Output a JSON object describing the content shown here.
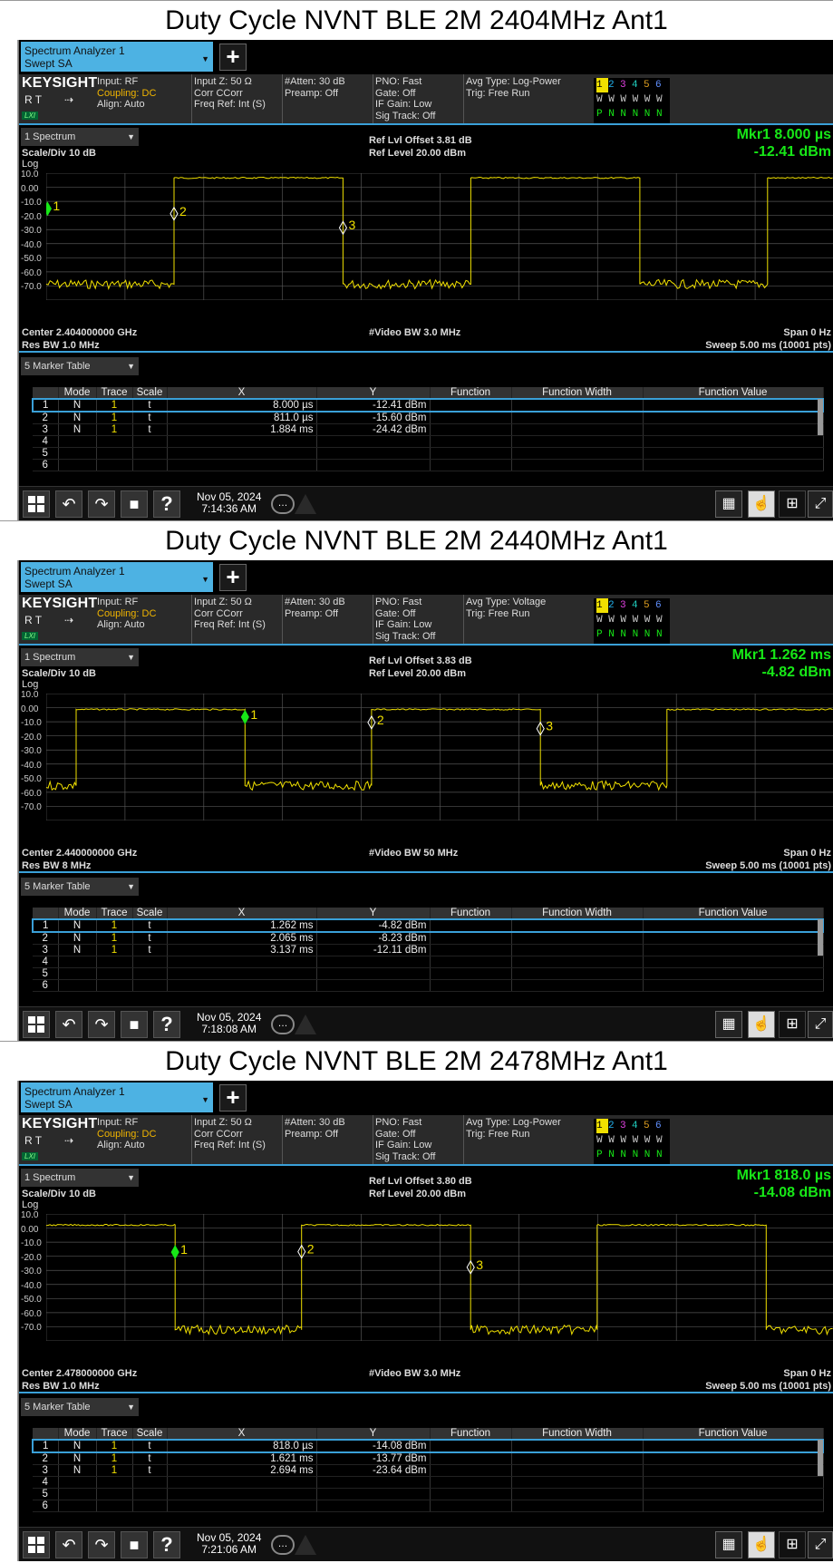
{
  "panels": [
    {
      "title": "Duty Cycle NVNT BLE 2M 2404MHz Ant1",
      "tab": {
        "line1": "Spectrum Analyzer 1",
        "line2": "Swept SA"
      },
      "brand": "KEYSIGHT",
      "rt": "R  T",
      "lxi": "LXI",
      "input": [
        "Input: RF",
        "Coupling: DC",
        "Align: Auto"
      ],
      "inputz": [
        "Input Z: 50 Ω",
        "Corr CCorr",
        "Freq Ref: Int (S)"
      ],
      "atten": [
        "#Atten: 30 dB",
        "Preamp: Off"
      ],
      "pno": [
        "PNO: Fast",
        "Gate: Off",
        "IF Gain: Low",
        "Sig Track: Off"
      ],
      "avg": [
        "Avg Type: Log-Power",
        "Trig: Free Run"
      ],
      "trace_rows": {
        "nums": [
          "1",
          "2",
          "3",
          "4",
          "5",
          "6"
        ],
        "w": "W W W W W W",
        "p": "P N N N N N"
      },
      "mode_label": "1 Spectrum",
      "scale_div": "Scale/Div 10 dB",
      "ref_offset": "Ref Lvl Offset 3.81 dB",
      "ref_level": "Ref Level 20.00 dBm",
      "mkr_line1": "Mkr1  8.000 µs",
      "mkr_line2": "-12.41 dBm",
      "log_label": "Log",
      "yticks": [
        "10.0",
        "0.00",
        "-10.0",
        "-20.0",
        "-30.0",
        "-40.0",
        "-50.0",
        "-60.0",
        "-70.0"
      ],
      "center": "Center 2.404000000 GHz",
      "res_bw": "Res BW 1.0 MHz",
      "video_bw": "#Video BW 3.0 MHz",
      "span": "Span 0 Hz",
      "sweep": "Sweep 5.00 ms (10001 pts)",
      "table_label": "5 Marker Table",
      "table_headers": [
        "",
        "Mode",
        "Trace",
        "Scale",
        "X",
        "Y",
        "Function",
        "Function Width",
        "Function Value"
      ],
      "rows": [
        {
          "n": "1",
          "mode": "N",
          "trace": "1",
          "scale": "t",
          "x": "8.000 µs",
          "y": "-12.41 dBm"
        },
        {
          "n": "2",
          "mode": "N",
          "trace": "1",
          "scale": "t",
          "x": "811.0 µs",
          "y": "-15.60 dBm"
        },
        {
          "n": "3",
          "mode": "N",
          "trace": "1",
          "scale": "t",
          "x": "1.884 ms",
          "y": "-24.42 dBm"
        },
        {
          "n": "4",
          "mode": "",
          "trace": "",
          "scale": "",
          "x": "",
          "y": ""
        },
        {
          "n": "5",
          "mode": "",
          "trace": "",
          "scale": "",
          "x": "",
          "y": ""
        },
        {
          "n": "6",
          "mode": "",
          "trace": "",
          "scale": "",
          "x": "",
          "y": ""
        }
      ],
      "date": "Nov 05, 2024",
      "time": "7:14:36 AM",
      "trace": {
        "high_db": 7,
        "low_db": -60,
        "edges_ms": [
          0.811,
          1.884,
          2.695,
          3.768,
          4.579
        ],
        "start_high": false
      },
      "markers": [
        {
          "label": "1",
          "t_ms": 0.008,
          "db": -12.41
        },
        {
          "label": "2",
          "t_ms": 0.811,
          "db": -15.6
        },
        {
          "label": "3",
          "t_ms": 1.884,
          "db": -24.42
        }
      ]
    },
    {
      "title": "Duty Cycle NVNT BLE 2M 2440MHz Ant1",
      "tab": {
        "line1": "Spectrum Analyzer 1",
        "line2": "Swept SA"
      },
      "brand": "KEYSIGHT",
      "rt": "R  T",
      "lxi": "LXI",
      "input": [
        "Input: RF",
        "Coupling: DC",
        "Align: Auto"
      ],
      "inputz": [
        "Input Z: 50 Ω",
        "Corr CCorr",
        "Freq Ref: Int (S)"
      ],
      "atten": [
        "#Atten: 30 dB",
        "Preamp: Off"
      ],
      "pno": [
        "PNO: Fast",
        "Gate: Off",
        "IF Gain: Low",
        "Sig Track: Off"
      ],
      "avg": [
        "Avg Type: Voltage",
        "Trig: Free Run"
      ],
      "trace_rows": {
        "nums": [
          "1",
          "2",
          "3",
          "4",
          "5",
          "6"
        ],
        "w": "W W W W W W",
        "p": "P N N N N N"
      },
      "mode_label": "1 Spectrum",
      "scale_div": "Scale/Div 10 dB",
      "ref_offset": "Ref Lvl Offset 3.83 dB",
      "ref_level": "Ref Level 20.00 dBm",
      "mkr_line1": "Mkr1  1.262 ms",
      "mkr_line2": "-4.82 dBm",
      "log_label": "Log",
      "yticks": [
        "10.0",
        "0.00",
        "-10.0",
        "-20.0",
        "-30.0",
        "-40.0",
        "-50.0",
        "-60.0",
        "-70.0"
      ],
      "center": "Center 2.440000000 GHz",
      "res_bw": "Res BW 8 MHz",
      "video_bw": "#Video BW 50 MHz",
      "span": "Span 0 Hz",
      "sweep": "Sweep 5.00 ms (10001 pts)",
      "table_label": "5 Marker Table",
      "table_headers": [
        "",
        "Mode",
        "Trace",
        "Scale",
        "X",
        "Y",
        "Function",
        "Function Width",
        "Function Value"
      ],
      "rows": [
        {
          "n": "1",
          "mode": "N",
          "trace": "1",
          "scale": "t",
          "x": "1.262 ms",
          "y": "-4.82 dBm"
        },
        {
          "n": "2",
          "mode": "N",
          "trace": "1",
          "scale": "t",
          "x": "2.065 ms",
          "y": "-8.23 dBm"
        },
        {
          "n": "3",
          "mode": "N",
          "trace": "1",
          "scale": "t",
          "x": "3.137 ms",
          "y": "-12.11 dBm"
        },
        {
          "n": "4",
          "mode": "",
          "trace": "",
          "scale": "",
          "x": "",
          "y": ""
        },
        {
          "n": "5",
          "mode": "",
          "trace": "",
          "scale": "",
          "x": "",
          "y": ""
        },
        {
          "n": "6",
          "mode": "",
          "trace": "",
          "scale": "",
          "x": "",
          "y": ""
        }
      ],
      "date": "Nov 05, 2024",
      "time": "7:18:08 AM",
      "trace": {
        "high_db": 0,
        "low_db": -48,
        "edges_ms": [
          0.19,
          1.262,
          2.065,
          3.137,
          3.94
        ],
        "start_high": false
      },
      "markers": [
        {
          "label": "1",
          "t_ms": 1.262,
          "db": -4.82
        },
        {
          "label": "2",
          "t_ms": 2.065,
          "db": -8.23
        },
        {
          "label": "3",
          "t_ms": 3.137,
          "db": -12.11
        }
      ]
    },
    {
      "title": "Duty Cycle NVNT BLE 2M 2478MHz Ant1",
      "tab": {
        "line1": "Spectrum Analyzer 1",
        "line2": "Swept SA"
      },
      "brand": "KEYSIGHT",
      "rt": "R  T",
      "lxi": "LXI",
      "input": [
        "Input: RF",
        "Coupling: DC",
        "Align: Auto"
      ],
      "inputz": [
        "Input Z: 50 Ω",
        "Corr CCorr",
        "Freq Ref: Int (S)"
      ],
      "atten": [
        "#Atten: 30 dB",
        "Preamp: Off"
      ],
      "pno": [
        "PNO: Fast",
        "Gate: Off",
        "IF Gain: Low",
        "Sig Track: Off"
      ],
      "avg": [
        "Avg Type: Log-Power",
        "Trig: Free Run"
      ],
      "trace_rows": {
        "nums": [
          "1",
          "2",
          "3",
          "4",
          "5",
          "6"
        ],
        "w": "W W W W W W",
        "p": "P N N N N N"
      },
      "mode_label": "1 Spectrum",
      "scale_div": "Scale/Div 10 dB",
      "ref_offset": "Ref Lvl Offset 3.80 dB",
      "ref_level": "Ref Level 20.00 dBm",
      "mkr_line1": "Mkr1  818.0 µs",
      "mkr_line2": "-14.08 dBm",
      "log_label": "Log",
      "yticks": [
        "10.0",
        "0.00",
        "-10.0",
        "-20.0",
        "-30.0",
        "-40.0",
        "-50.0",
        "-60.0",
        "-70.0"
      ],
      "center": "Center 2.478000000 GHz",
      "res_bw": "Res BW 1.0 MHz",
      "video_bw": "#Video BW 3.0 MHz",
      "span": "Span 0 Hz",
      "sweep": "Sweep 5.00 ms (10001 pts)",
      "table_label": "5 Marker Table",
      "table_headers": [
        "",
        "Mode",
        "Trace",
        "Scale",
        "X",
        "Y",
        "Function",
        "Function Width",
        "Function Value"
      ],
      "rows": [
        {
          "n": "1",
          "mode": "N",
          "trace": "1",
          "scale": "t",
          "x": "818.0 µs",
          "y": "-14.08 dBm"
        },
        {
          "n": "2",
          "mode": "N",
          "trace": "1",
          "scale": "t",
          "x": "1.621 ms",
          "y": "-13.77 dBm"
        },
        {
          "n": "3",
          "mode": "N",
          "trace": "1",
          "scale": "t",
          "x": "2.694 ms",
          "y": "-23.64 dBm"
        },
        {
          "n": "4",
          "mode": "",
          "trace": "",
          "scale": "",
          "x": "",
          "y": ""
        },
        {
          "n": "5",
          "mode": "",
          "trace": "",
          "scale": "",
          "x": "",
          "y": ""
        },
        {
          "n": "6",
          "mode": "",
          "trace": "",
          "scale": "",
          "x": "",
          "y": ""
        }
      ],
      "date": "Nov 05, 2024",
      "time": "7:21:06 AM",
      "trace": {
        "high_db": 3,
        "low_db": -63,
        "edges_ms": [
          0.818,
          1.621,
          2.694,
          3.497,
          4.57
        ],
        "start_high": true
      },
      "markers": [
        {
          "label": "1",
          "t_ms": 0.818,
          "db": -14.08
        },
        {
          "label": "2",
          "t_ms": 1.621,
          "db": -13.77
        },
        {
          "label": "3",
          "t_ms": 2.694,
          "db": -23.64
        }
      ]
    }
  ],
  "colors": {
    "trace": "#f0e000",
    "marker_active": "#17e817",
    "accent": "#3aa0d8",
    "tab": "#4db2e3",
    "warn": "#f0b400"
  },
  "plot_axes": {
    "x_start_ms": 0,
    "x_end_ms": 5,
    "y_top_db": 20,
    "y_bottom_db": -80
  }
}
